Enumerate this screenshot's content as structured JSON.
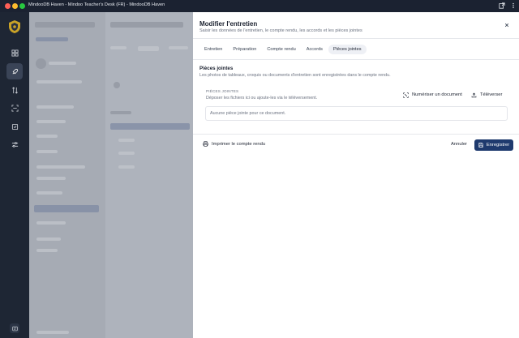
{
  "window": {
    "title": "MindooDB Haven - Mindoo Teacher's Desk (FR) - MindooDB Haven"
  },
  "icons": {
    "rail": [
      "dashboard-icon",
      "rocket-icon",
      "transfer-icon",
      "scan-icon",
      "document-check-icon",
      "sliders-icon"
    ],
    "rail_bottom": "panel-icon"
  },
  "dialog": {
    "title": "Modifier l'entretien",
    "subtitle": "Saisir les données de l'entretien, le compte rendu, les accords et les pièces jointes",
    "tabs": [
      {
        "label": "Entretien"
      },
      {
        "label": "Préparation"
      },
      {
        "label": "Compte rendu"
      },
      {
        "label": "Accords"
      },
      {
        "label": "Pièces jointes"
      }
    ],
    "active_tab": "Pièces jointes",
    "section": {
      "title": "Pièces jointes",
      "description": "Les photos de tableaux, croquis ou documents d'entretien sont enregistrées dans le compte rendu."
    },
    "attachments": {
      "label": "PIÈCES JOINTES",
      "hint": "Déposer les fichiers ici ou ajoute-les via le téléversement.",
      "scan_label": "Numériser un document",
      "upload_label": "Téléverser",
      "empty_text": "Aucune pièce jointe pour ce document."
    },
    "footer": {
      "print_label": "Imprimer le compte rendu",
      "cancel_label": "Annuler",
      "save_label": "Enregistrer"
    }
  },
  "colors": {
    "accent": "#1f3a6e",
    "rail_bg": "#1e2634",
    "active_tab_bg": "#eef0f5"
  }
}
